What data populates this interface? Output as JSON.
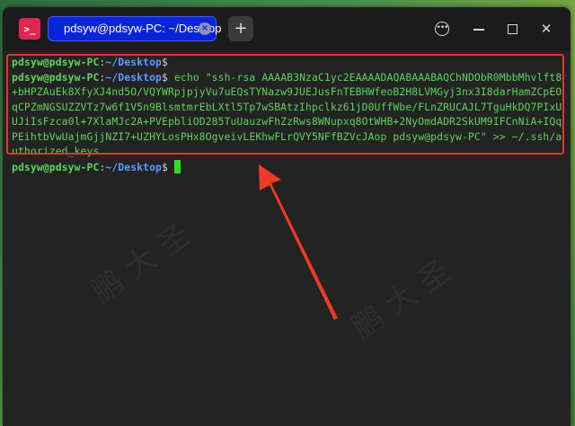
{
  "window": {
    "app_icon": "terminal-icon",
    "tab_title": "pdsyw@pdsyw-PC: ~/Desktop",
    "add_tab_label": "+",
    "controls": [
      "menu-icon",
      "minimize-icon",
      "maximize-icon",
      "close-icon"
    ]
  },
  "terminal": {
    "prompt_user": "pdsyw@pdsyw-PC",
    "prompt_colon": ":",
    "prompt_path": "~/Desktop",
    "prompt_dollar": "$",
    "lines": [
      {
        "type": "prompt",
        "command": ""
      },
      {
        "type": "prompt",
        "command": " echo \"ssh-rsa AAAAB3NzaC1yc2EAAAADAQABAAABAQChNDObR0MbbMhvlft8"
      },
      {
        "type": "output",
        "text": "+bHPZAuEk8XfyXJ4nd5O/VQYWRpjpjyVu7uEQsTYNazw9JUEJusFnTEBHWfeoB2H8LVMGyj3nx3I8darHamZCpEO"
      },
      {
        "type": "output",
        "text": "qCPZmNGSUZZVTz7w6f1V5n9BlsmtmrEbLXtl5Tp7wSBAtzIhpclkz61jD0UffWbe/FLnZRUCAJL7TguHkDQ7PIxU"
      },
      {
        "type": "output",
        "text": "UJiIsFzca0l+7XlaMJc2A+PVEpbliOD285TuUauzwFhZzRws8WNupxq8OtWHB+2NyOmdADR2SkUM9IFCnNiA+IQq"
      },
      {
        "type": "output",
        "text": "PEihtbVwUajmGjjNZI7+UZHYLosPHx8OgveivLEKhwFLrQVY5NFfBZVcJAop pdsyw@pdsyw-PC\" >> ~/.ssh/a"
      },
      {
        "type": "output",
        "text": "uthorized_keys"
      },
      {
        "type": "prompt_cursor",
        "command": " "
      }
    ]
  },
  "annotation": {
    "box_color": "#e4342a",
    "arrow_color": "#f03a24"
  },
  "watermark_text": "鹏 大 圣"
}
